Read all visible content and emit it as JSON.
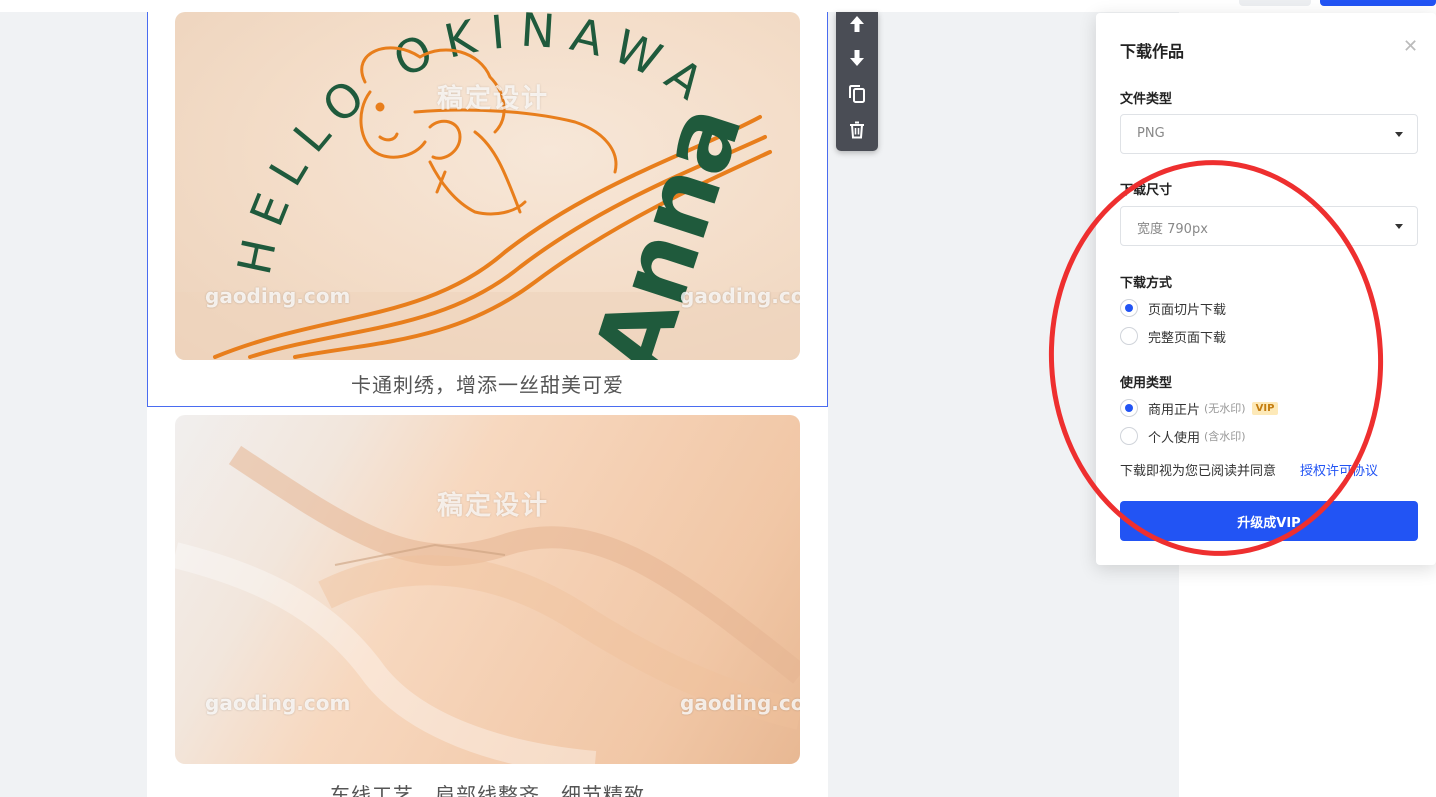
{
  "canvas": {
    "caption_1": "卡通刺绣，增添一丝甜美可爱",
    "caption_2": "车线工艺，肩部线整齐，细节精致",
    "artwork_text": {
      "arc_text": "HELLO OKINAWA",
      "name_text": "Anna"
    },
    "watermark_cn": "稿定设计",
    "watermark_en": "gaoding.com"
  },
  "toolbar": {
    "items": [
      {
        "name": "move-up",
        "icon": "arrow-up-icon"
      },
      {
        "name": "move-down",
        "icon": "arrow-down-icon"
      },
      {
        "name": "duplicate",
        "icon": "copy-icon"
      },
      {
        "name": "delete",
        "icon": "trash-icon"
      }
    ]
  },
  "download_panel": {
    "title": "下载作品",
    "close_icon": "close-icon",
    "file_type": {
      "label": "文件类型",
      "value": "PNG"
    },
    "download_size": {
      "label": "下载尺寸",
      "value": "宽度 790px"
    },
    "download_method": {
      "label": "下载方式",
      "options": [
        {
          "label": "页面切片下载",
          "selected": true
        },
        {
          "label": "完整页面下载",
          "selected": false
        }
      ]
    },
    "usage_type": {
      "label": "使用类型",
      "options": [
        {
          "label": "商用正片",
          "sub": "(无水印)",
          "badge": "VIP",
          "selected": true
        },
        {
          "label": "个人使用",
          "sub": "(含水印)",
          "selected": false
        }
      ]
    },
    "agreement_text": "下载即视为您已阅读并同意",
    "agreement_link": "授权许可协议",
    "upgrade_button": "升级成VIP"
  },
  "colors": {
    "accent": "#2254f4",
    "annotation": "#ee2f2f",
    "toolbar_bg": "#4a4d55",
    "embroidery_orange": "#e87e1c",
    "embroidery_green": "#1f5a3c"
  }
}
